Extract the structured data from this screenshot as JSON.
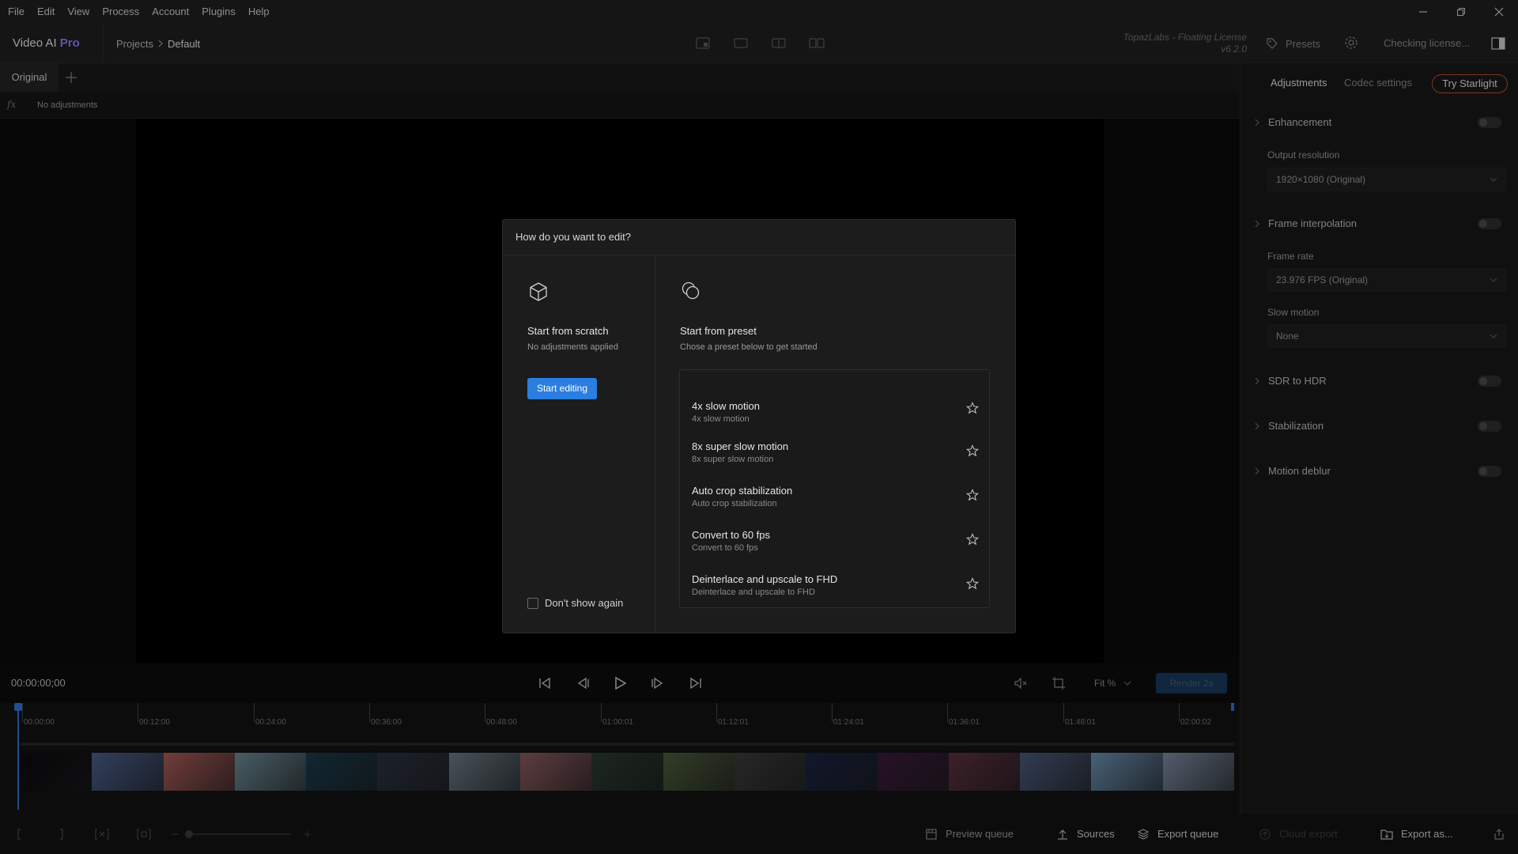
{
  "menu": [
    "File",
    "Edit",
    "View",
    "Process",
    "Account",
    "Plugins",
    "Help"
  ],
  "header": {
    "app_name": "Video AI",
    "app_tier": "Pro",
    "breadcrumb": [
      "Projects",
      "Default"
    ],
    "license_line1": "TopazLabs - Floating License",
    "license_line2": "v6.2.0",
    "presets_label": "Presets",
    "license_status": "Checking license..."
  },
  "tabs": {
    "original": "Original",
    "no_adjustments": "No adjustments",
    "fx": "fx"
  },
  "transport": {
    "timecode": "00:00:00;00",
    "fit_label": "Fit %",
    "render_label": "Render 2s"
  },
  "timeline": {
    "ticks": [
      "00:00:00",
      "00:12:00",
      "00:24:00",
      "00:36:00",
      "00:48:00",
      "01:00:01",
      "01:12:01",
      "01:24:01",
      "01:36:01",
      "01:48:01",
      "02:00:02"
    ],
    "frame_colors": [
      "#0c0c10",
      "#4a5e8c",
      "#a85a58",
      "#6a8a96",
      "#1a3a4a",
      "#2a3240",
      "#6a7a86",
      "#8a5a60",
      "#2a3a2e",
      "#4a5a3a",
      "#3a3a3a",
      "#1a2240",
      "#3a1a3a",
      "#5a3040",
      "#4a5a7a",
      "#6a90b0",
      "#7a8aa0"
    ]
  },
  "bottom_bar": {
    "preview_queue": "Preview queue",
    "sources": "Sources",
    "export_queue": "Export queue",
    "cloud_export": "Cloud export",
    "export_as": "Export as..."
  },
  "right_panel": {
    "tab_adjustments": "Adjustments",
    "tab_codec": "Codec settings",
    "try_starlight": "Try Starlight",
    "enhancement": "Enhancement",
    "output_resolution_label": "Output resolution",
    "output_resolution_value": "1920×1080 (Original)",
    "frame_interpolation": "Frame interpolation",
    "frame_rate_label": "Frame rate",
    "frame_rate_value": "23.976 FPS (Original)",
    "slow_motion_label": "Slow motion",
    "slow_motion_value": "None",
    "sdr_to_hdr": "SDR to HDR",
    "stabilization": "Stabilization",
    "motion_deblur": "Motion deblur"
  },
  "modal": {
    "title": "How do you want to edit?",
    "scratch_title": "Start from scratch",
    "scratch_subtitle": "No adjustments applied",
    "start_editing": "Start editing",
    "dont_show_again": "Don't show again",
    "preset_title": "Start from preset",
    "preset_subtitle": "Chose a preset below to get started",
    "presets": [
      {
        "name": "4x slow motion",
        "desc": "4x slow motion"
      },
      {
        "name": "8x super slow motion",
        "desc": "8x super slow motion"
      },
      {
        "name": "Auto crop stabilization",
        "desc": "Auto crop stabilization"
      },
      {
        "name": "Convert to 60 fps",
        "desc": "Convert to 60 fps"
      },
      {
        "name": "Deinterlace and upscale to FHD",
        "desc": "Deinterlace and upscale to FHD"
      }
    ]
  },
  "colors": {
    "accent": "#2a7ee0",
    "pro": "#8f7cff",
    "starlight_border": "#b85030",
    "playhead": "#2f74d6"
  }
}
